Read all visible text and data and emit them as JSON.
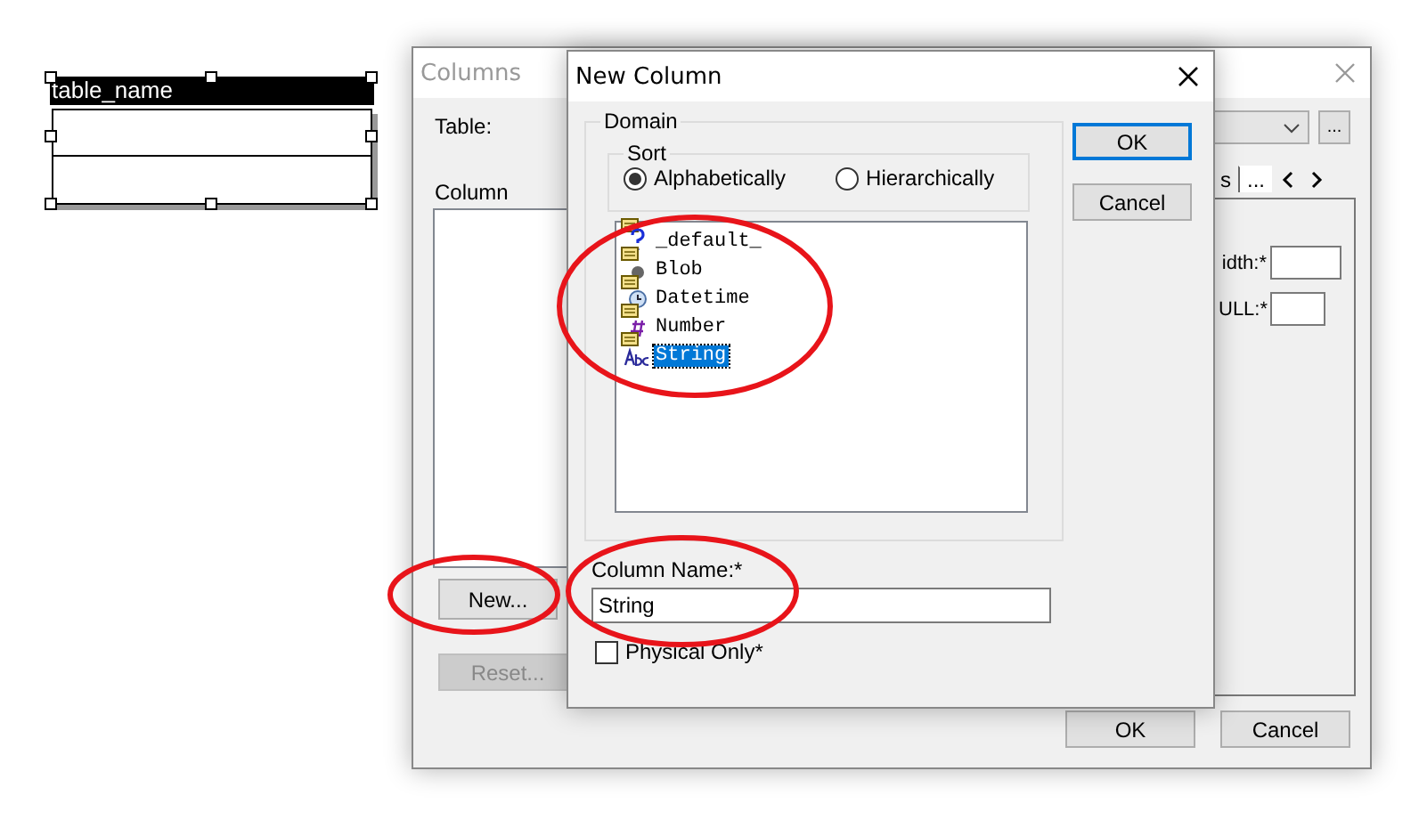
{
  "entity": {
    "name": "table_name"
  },
  "columns_window": {
    "title": "Columns",
    "table_label": "Table:",
    "combo_more": "...",
    "tabs": [
      {
        "label": "s",
        "selected": false
      },
      {
        "label": "...",
        "selected": true
      }
    ],
    "column_label": "Column",
    "new_button": "New...",
    "reset_button": {
      "label": "Reset...",
      "disabled": true
    },
    "fields": [
      {
        "label": "idth:*"
      },
      {
        "label": "ULL:*"
      }
    ],
    "ok": "OK",
    "cancel": "Cancel"
  },
  "dialog": {
    "title": "New Column",
    "domain_label": "Domain",
    "sort_label": "Sort",
    "sort_options": [
      {
        "label": "Alphabetically",
        "selected": true
      },
      {
        "label": "Hierarchically",
        "selected": false
      }
    ],
    "domains": [
      {
        "kind": "unknown",
        "label": "_default_",
        "selected": false
      },
      {
        "kind": "blob",
        "label": "Blob",
        "selected": false
      },
      {
        "kind": "datetime",
        "label": "Datetime",
        "selected": false
      },
      {
        "kind": "number",
        "label": "Number",
        "selected": false
      },
      {
        "kind": "string",
        "label": "String",
        "selected": true
      }
    ],
    "column_name_label": "Column Name:*",
    "column_name": "String",
    "physical_only": {
      "label": "Physical Only*",
      "checked": false
    },
    "ok": "OK",
    "cancel": "Cancel"
  }
}
